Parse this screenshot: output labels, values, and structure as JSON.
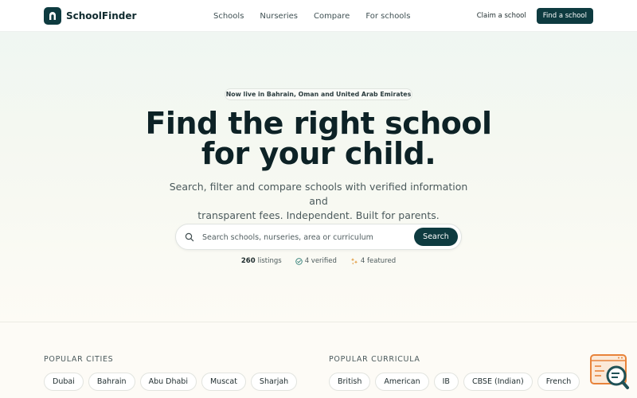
{
  "brand": {
    "name": "SchoolFinder"
  },
  "nav": {
    "items": [
      {
        "label": "Schools"
      },
      {
        "label": "Nurseries"
      },
      {
        "label": "Compare"
      },
      {
        "label": "For schools"
      }
    ]
  },
  "header_actions": {
    "claim_label": "Claim a school",
    "find_label": "Find a school"
  },
  "hero": {
    "badge": "Now live in Bahrain, Oman and United Arab Emirates",
    "headline_line1": "Find the right school",
    "headline_line2": "for your child.",
    "subhead_line1": "Search, filter and compare schools with verified information and",
    "subhead_line2": "transparent fees. Independent. Built for parents."
  },
  "search": {
    "placeholder": "Search schools, nurseries, area or curriculum",
    "value": "",
    "button_label": "Search"
  },
  "stats": {
    "listings_count": "260",
    "listings_label": "listings",
    "verified": "4 verified",
    "featured": "4 featured"
  },
  "popular_cities": {
    "title": "POPULAR CITIES",
    "items": [
      "Dubai",
      "Bahrain",
      "Abu Dhabi",
      "Muscat",
      "Sharjah"
    ]
  },
  "popular_curricula": {
    "title": "POPULAR CURRICULA",
    "items": [
      "British",
      "American",
      "IB",
      "CBSE (Indian)",
      "French"
    ]
  },
  "colors": {
    "brand_dark": "#0e3b40",
    "widget_orange": "#e8833a",
    "widget_teal": "#1f5156"
  },
  "icons": [
    "logo-icon",
    "search-icon",
    "verified-icon",
    "featured-icon",
    "help-widget-icon"
  ]
}
